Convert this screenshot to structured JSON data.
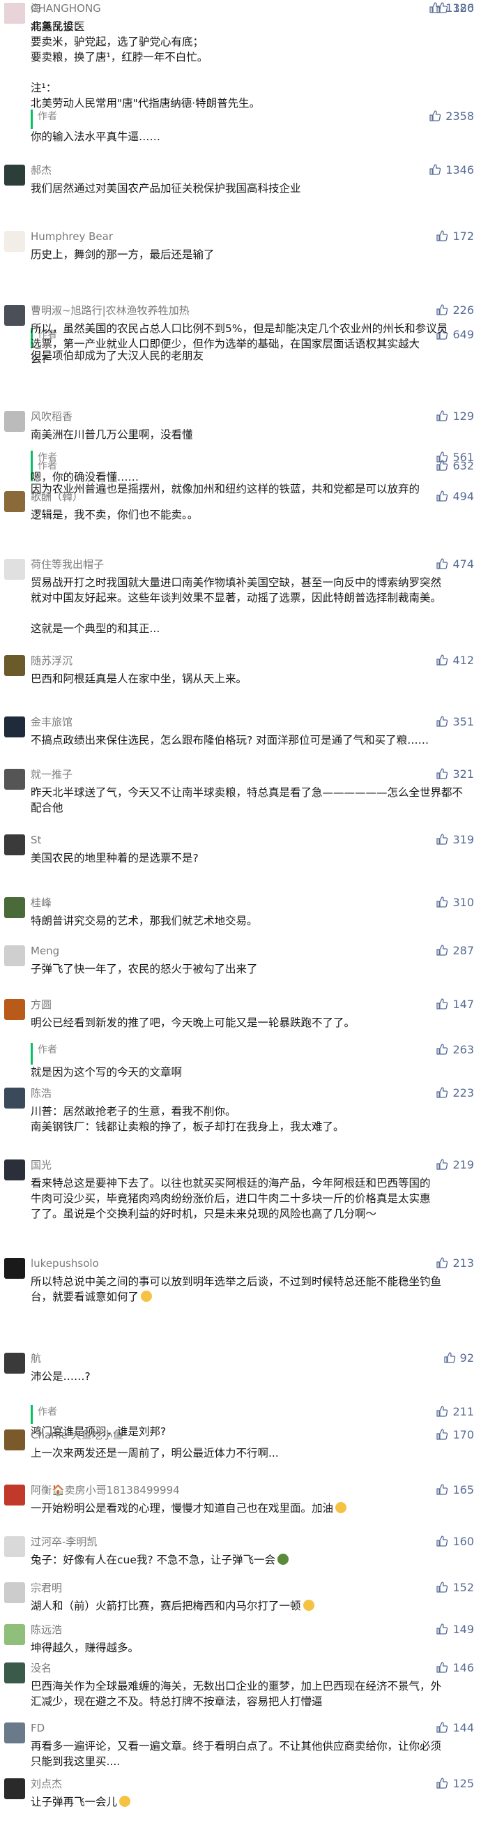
{
  "thumb_icon": "thumbs-up-icon",
  "reply_label": "作者",
  "accent_color": "#576b95",
  "reply_bar_color": "#07c160",
  "comments": [
    {
      "author": "海",
      "likes": "1386",
      "avatar_color": "#7a1f1f",
      "avatar_char": "海",
      "lines": [
        "北美民谚：",
        "要卖米，驴党起，选了驴党心有底；",
        "要卖粮，换了唐¹，红脖一年不白忙。",
        "",
        "注¹：",
        "北美劳动人民常用\"唐\"代指唐纳德·特朗普先生。"
      ],
      "reply": {
        "likes": "2358",
        "lines": [
          "你的输入法水平真牛逼……"
        ]
      }
    },
    {
      "author": "郝杰",
      "likes": "1346",
      "avatar_color": "#2c3e3a",
      "avatar_char": "郝",
      "lines": [
        "我们居然通过对美国农产品加征关税保护我国高科技企业"
      ]
    },
    {
      "author": "Humphrey Bear",
      "likes": "172",
      "avatar_color": "#f2ede6",
      "avatar_char": "H",
      "lines": [
        "历史上，舞剑的那一方，最后还是输了"
      ],
      "reply": {
        "likes": "649",
        "lines": [
          "但是项伯却成为了大汉人民的老朋友"
        ]
      }
    },
    {
      "author": "曹明淑~旭路行|农林渔牧养牲加热",
      "likes": "226",
      "avatar_color": "#4a4f58",
      "avatar_char": "曹",
      "lines": [
        "所以，虽然美国的农民占总人口比例不到5%，但是却能决定几个农业州的州长和参议员",
        "选票，第一产业就业人口即便少，但作为选举的基础，在国家层面话语权其实越大",
        "么?"
      ],
      "reply": {
        "likes": "632",
        "lines": [
          "因为农业州普遍也是摇摆州，就像加州和纽约这样的铁蓝，共和党都是可以放弃的"
        ]
      }
    },
    {
      "author": "风吹稻香",
      "likes": "129",
      "avatar_color": "#bbbbbb",
      "avatar_char": "风",
      "lines": [
        "南美洲在川普几万公里啊，没看懂"
      ],
      "reply": {
        "likes": "561",
        "lines": [
          "嗯，你的确没看懂……"
        ]
      }
    },
    {
      "author": "歌酬（韓）",
      "likes": "494",
      "avatar_color": "#8a6a3a",
      "avatar_char": "歌",
      "lines": [
        "逻辑是，我不卖，你们也不能卖。。"
      ]
    },
    {
      "author": "荷住等我出帽子",
      "likes": "474",
      "avatar_color": "#e0e0e0",
      "avatar_char": "荷",
      "lines": [
        "贸易战开打之时我国就大量进口南美作物填补美国空缺，甚至一向反中的博索纳罗突然",
        "就对中国友好起来。这些年谈判效果不显著，动摇了选票，因此特朗普选择制裁南美。",
        "",
        "这就是一个典型的和其正..."
      ]
    },
    {
      "author": "随苏浮沉",
      "likes": "412",
      "avatar_color": "#6b5b2a",
      "avatar_char": "随",
      "lines": [
        "巴西和阿根廷真是人在家中坐，锅从天上来。"
      ]
    },
    {
      "author": "金丰旅馆",
      "likes": "351",
      "avatar_color": "#1f2a3a",
      "avatar_char": "金",
      "lines": [
        "不搞点政绩出来保住选民，怎么跟布隆伯格玩? 对面洋那位可是通了气和买了粮……"
      ]
    },
    {
      "author": "就一推子",
      "likes": "321",
      "avatar_color": "#555555",
      "avatar_char": "就",
      "lines": [
        "昨天北半球送了气，今天又不让南半球卖粮，特总真是看了急——————怎么全世界都不",
        "配合他"
      ]
    },
    {
      "author": "St",
      "likes": "319",
      "avatar_color": "#3a3a3a",
      "avatar_char": "S",
      "lines": [
        "美国农民的地里种着的是选票不是?"
      ]
    },
    {
      "author": "桂峰",
      "likes": "310",
      "avatar_color": "#4a6a3a",
      "avatar_char": "桂",
      "lines": [
        "特朗普讲究交易的艺术，那我们就艺术地交易。"
      ]
    },
    {
      "author": "Meng",
      "likes": "287",
      "avatar_color": "#cfcfcf",
      "avatar_char": "M",
      "lines": [
        "子弹飞了快一年了，农民的怒火于被勾了出来了"
      ]
    },
    {
      "author": "方圆",
      "likes": "147",
      "avatar_color": "#b85a1a",
      "avatar_char": "方",
      "lines": [
        "明公已经看到新发的推了吧，今天晚上可能又是一轮暴跌跑不了了。"
      ],
      "reply": {
        "likes": "263",
        "lines": [
          "就是因为这个写的今天的文章啊"
        ]
      }
    },
    {
      "author": "陈浩",
      "likes": "223",
      "avatar_color": "#3a4a5a",
      "avatar_char": "陈",
      "lines": [
        "川普：居然敢抢老子的生意，看我不削你。",
        "南美钢铁厂：钱都让卖粮的挣了，板子却打在我身上，我太难了。"
      ]
    },
    {
      "author": "国光",
      "likes": "219",
      "avatar_color": "#2a2f3a",
      "avatar_char": "国",
      "lines": [
        "看来特总这是要神下去了。以往也就买买阿根廷的海产品，今年阿根廷和巴西等国的",
        "牛肉可没少买，毕竟猪肉鸡肉纷纷涨价后，进口牛肉二十多块一斤的价格真是太实惠",
        "了了。虽说是个交换利益的好时机，只是未来兑现的风险也高了几分啊～"
      ]
    },
    {
      "author": "lukepushsolo",
      "likes": "213",
      "avatar_color": "#1a1a1a",
      "avatar_char": "L",
      "lines": [
        "所以特总说中美之间的事可以放到明年选举之后谈，不过到时候特总还能不能稳坐钓鱼",
        "台，就要看诚意如何了"
      ],
      "emoji_line": 1,
      "emoji_color": "#f5c242"
    },
    {
      "author": "航",
      "likes": "92",
      "avatar_color": "#3a3a3a",
      "avatar_char": "航",
      "lines": [
        "沛公是……?"
      ],
      "reply": {
        "likes": "211",
        "lines": [
          "鸿门宴谁是项羽，谁是刘邦?"
        ]
      }
    },
    {
      "author": "Charlie 大鱼吃小鱼",
      "likes": "170",
      "avatar_color": "#7a5a2a",
      "avatar_char": "C",
      "lines": [
        "上一次来两发还是一周前了，明公最近体力不行啊..."
      ]
    },
    {
      "author": "阿衡🏠卖房小哥18138499994",
      "likes": "165",
      "avatar_color": "#c0392b",
      "avatar_char": "阿",
      "lines": [
        "一开始粉明公是看戏的心理，慢慢才知道自己也在戏里面。加油"
      ],
      "emoji_line": 0,
      "emoji_color": "#f5c242"
    },
    {
      "author": "过河卒-李明凯",
      "likes": "160",
      "avatar_color": "#d9d9d9",
      "avatar_char": "过",
      "lines": [
        "兔子：好像有人在cue我? 不急不急，让子弹飞一会"
      ],
      "emoji_line": 0,
      "emoji_color": "#5a8a3a"
    },
    {
      "author": "宗君明",
      "likes": "152",
      "avatar_color": "#cccccc",
      "avatar_char": "宗",
      "lines": [
        "湖人和（前）火箭打比赛，赛后把梅西和内马尔打了一顿"
      ],
      "emoji_line": 0,
      "emoji_color": "#f5c242"
    },
    {
      "author": "陈远浩",
      "likes": "149",
      "avatar_color": "#8fbf7a",
      "avatar_char": "陈",
      "lines": [
        "坤得越久，赚得越多。"
      ]
    },
    {
      "author": "没名",
      "likes": "146",
      "avatar_color": "#3a5a4a",
      "avatar_char": "没",
      "lines": [
        "巴西海关作为全球最难缠的海关，无数出口企业的噩梦，加上巴西现在经济不景气，外",
        "汇减少，现在避之不及。特总打牌不按章法，容易把人打懵逼"
      ]
    },
    {
      "author": "FD",
      "likes": "144",
      "avatar_color": "#6a7a8a",
      "avatar_char": "F",
      "lines": [
        "再看多一遍评论，又看一遍文章。终于看明白点了。不让其他供应商卖给你，让你必须",
        "只能到我这里买...."
      ]
    },
    {
      "author": "刘点杰",
      "likes": "125",
      "avatar_color": "#2a2a2a",
      "avatar_char": "刘",
      "lines": [
        "让子弹再飞一会儿"
      ],
      "emoji_line": 0,
      "emoji_color": "#f5c242"
    },
    {
      "author": "CHANGHONG",
      "likes": "120",
      "avatar_color": "#e8d4d8",
      "avatar_char": "C",
      "lines": [
        "病急乱投医"
      ]
    }
  ]
}
